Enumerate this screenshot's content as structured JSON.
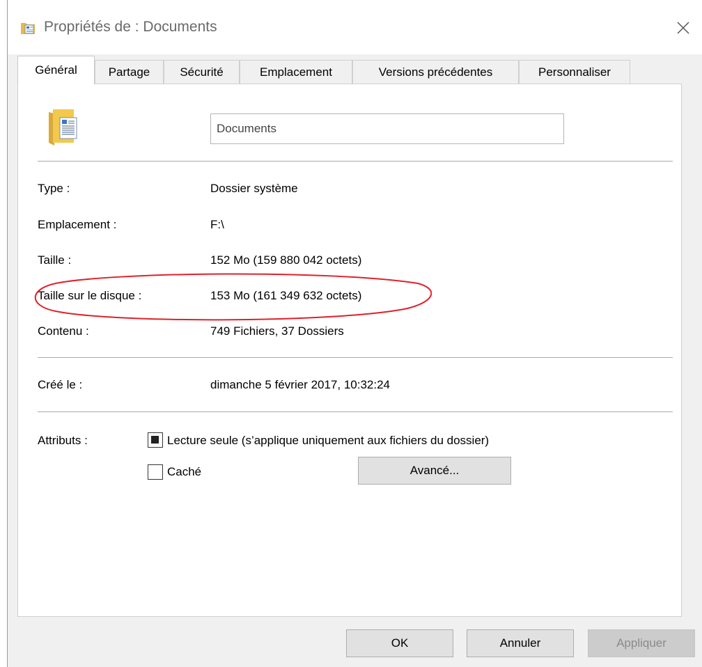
{
  "window": {
    "title": "Propriétés de : Documents",
    "close_label": "×"
  },
  "tabs": [
    {
      "label": "Général",
      "active": true
    },
    {
      "label": "Partage",
      "active": false
    },
    {
      "label": "Sécurité",
      "active": false
    },
    {
      "label": "Emplacement",
      "active": false
    },
    {
      "label": "Versions précédentes",
      "active": false
    },
    {
      "label": "Personnaliser",
      "active": false
    }
  ],
  "general": {
    "folder_name": "Documents",
    "properties": [
      {
        "label": "Type :",
        "value": "Dossier système"
      },
      {
        "label": "Emplacement :",
        "value": "F:\\"
      },
      {
        "label": "Taille :",
        "value": "152 Mo (159 880 042 octets)"
      },
      {
        "label": "Taille sur le disque :",
        "value": "153 Mo (161 349 632 octets)"
      },
      {
        "label": "Contenu :",
        "value": "749 Fichiers, 37 Dossiers"
      }
    ],
    "created": {
      "label": "Créé le :",
      "value": "dimanche 5 février 2017, 10:32:24"
    },
    "attributes": {
      "label": "Attributs :",
      "read_only": {
        "label": "Lecture seule (s’applique uniquement aux fichiers du dossier)",
        "state": "indeterminate"
      },
      "hidden": {
        "label": "Caché",
        "checked": false
      },
      "advanced_button": "Avancé..."
    }
  },
  "buttons": {
    "ok": "OK",
    "cancel": "Annuler",
    "apply": "Appliquer",
    "apply_enabled": false
  },
  "colors": {
    "highlight_ellipse": "#e0202a",
    "folder_yellow": "#f2c94c"
  }
}
